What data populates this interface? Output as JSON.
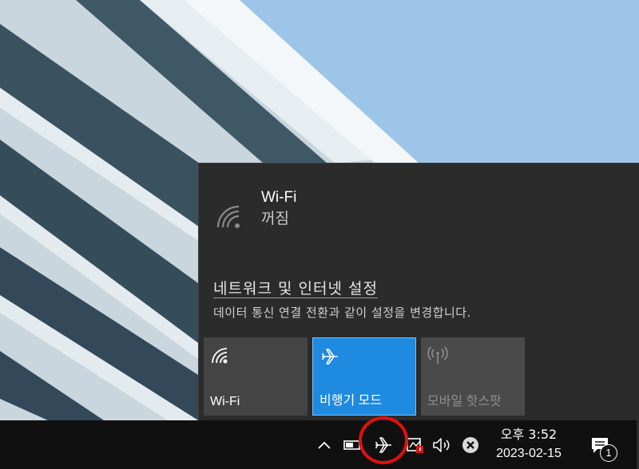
{
  "flyout": {
    "wifi_name": "Wi-Fi",
    "wifi_state": "꺼짐",
    "settings_link": "네트워크 및 인터넷 설정",
    "settings_desc": "데이터 통신 연결 전환과 같이 설정을 변경합니다.",
    "tiles": [
      {
        "label": "Wi-Fi",
        "icon": "wifi-icon",
        "active": false
      },
      {
        "label": "비행기 모드",
        "icon": "airplane-icon",
        "active": true
      },
      {
        "label": "모바일 핫스팟",
        "icon": "hotspot-icon",
        "active": false,
        "disabled": true
      }
    ],
    "colors": {
      "background": "#2b2b2b",
      "tile": "#444444",
      "active_tile": "#1e8ae0"
    }
  },
  "taskbar": {
    "tray_icons": [
      "chevron-up-icon",
      "battery-icon",
      "airplane-icon",
      "security-icon",
      "volume-icon",
      "close-circle-icon"
    ],
    "clock": {
      "period_time": "오후 3:52",
      "date": "2023-02-15"
    },
    "notification_count": "1",
    "highlight_color": "#e01010"
  }
}
